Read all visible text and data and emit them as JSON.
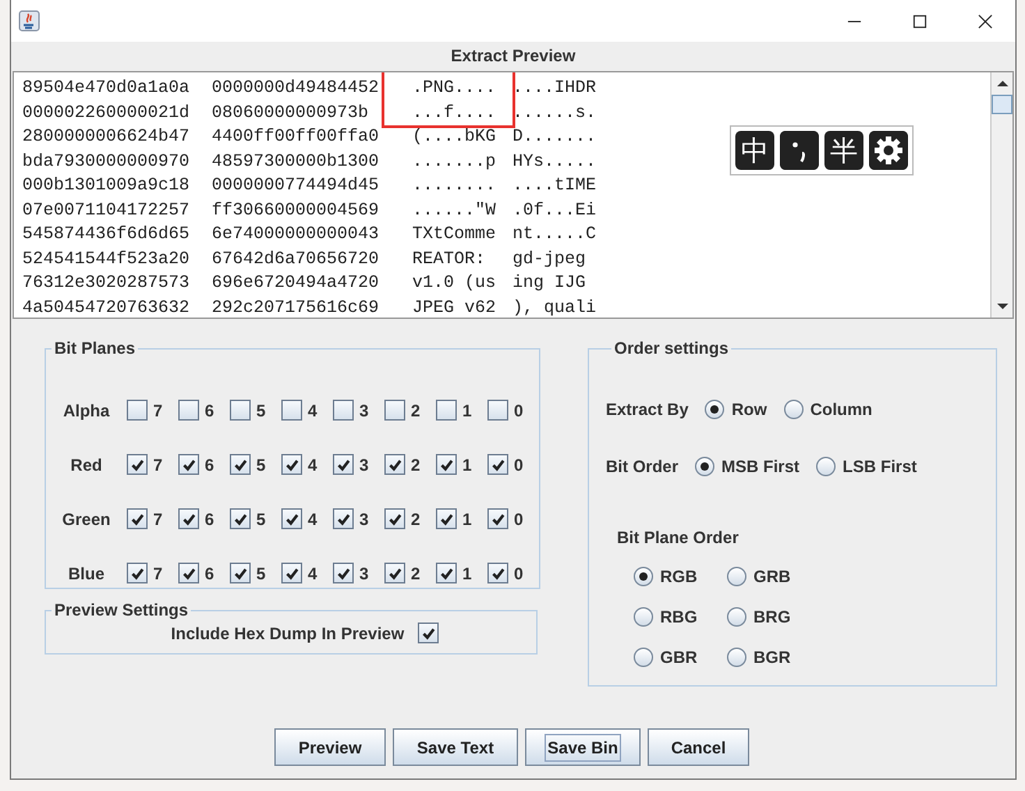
{
  "window": {
    "title": "Extract Preview"
  },
  "preview": {
    "rows": [
      {
        "hex": [
          "89504e470d0a1a0a",
          "0000000d49484452"
        ],
        "ascii": [
          ".PNG....",
          "....IHDR"
        ]
      },
      {
        "hex": [
          "000002260000021d",
          "08060000000973b"
        ],
        "ascii": [
          "...f....",
          "......s."
        ]
      },
      {
        "hex": [
          "2800000006624b47",
          "4400ff00ff00ffa0"
        ],
        "ascii": [
          "(....bKG",
          "D......."
        ]
      },
      {
        "hex": [
          "bda7930000000970",
          "48597300000b1300"
        ],
        "ascii": [
          ".......p",
          "HYs....."
        ]
      },
      {
        "hex": [
          "000b1301009a9c18",
          "0000000774494d45"
        ],
        "ascii": [
          "........",
          "....tIME"
        ]
      },
      {
        "hex": [
          "07e0071104172257",
          "ff30660000004569"
        ],
        "ascii": [
          "......\"W",
          ".0f...Ei"
        ]
      },
      {
        "hex": [
          "545874436f6d6d65",
          "6e74000000000043"
        ],
        "ascii": [
          "TXtComme",
          "nt.....C"
        ]
      },
      {
        "hex": [
          "524541544f523a20",
          "67642d6a70656720"
        ],
        "ascii": [
          "REATOR: ",
          "gd-jpeg"
        ]
      },
      {
        "hex": [
          "76312e3020287573",
          "696e6720494a4720"
        ],
        "ascii": [
          "v1.0 (us",
          "ing IJG"
        ]
      },
      {
        "hex": [
          "4a50454720763632",
          "292c207175616c69"
        ],
        "ascii": [
          "JPEG v62",
          "), quali"
        ]
      }
    ],
    "highlight": {
      "color": "#e8322e"
    }
  },
  "ime_toolbar": {
    "items": [
      {
        "kind": "text",
        "label": "中"
      },
      {
        "kind": "punctuation"
      },
      {
        "kind": "text",
        "label": "半"
      },
      {
        "kind": "settings"
      }
    ]
  },
  "bit_planes": {
    "title": "Bit Planes",
    "channels": [
      {
        "name": "Alpha",
        "bits": [
          {
            "label": "7",
            "checked": false
          },
          {
            "label": "6",
            "checked": false
          },
          {
            "label": "5",
            "checked": false
          },
          {
            "label": "4",
            "checked": false
          },
          {
            "label": "3",
            "checked": false
          },
          {
            "label": "2",
            "checked": false
          },
          {
            "label": "1",
            "checked": false
          },
          {
            "label": "0",
            "checked": false
          }
        ]
      },
      {
        "name": "Red",
        "bits": [
          {
            "label": "7",
            "checked": true
          },
          {
            "label": "6",
            "checked": true
          },
          {
            "label": "5",
            "checked": true
          },
          {
            "label": "4",
            "checked": true
          },
          {
            "label": "3",
            "checked": true
          },
          {
            "label": "2",
            "checked": true
          },
          {
            "label": "1",
            "checked": true
          },
          {
            "label": "0",
            "checked": true
          }
        ]
      },
      {
        "name": "Green",
        "bits": [
          {
            "label": "7",
            "checked": true
          },
          {
            "label": "6",
            "checked": true
          },
          {
            "label": "5",
            "checked": true
          },
          {
            "label": "4",
            "checked": true
          },
          {
            "label": "3",
            "checked": true
          },
          {
            "label": "2",
            "checked": true
          },
          {
            "label": "1",
            "checked": true
          },
          {
            "label": "0",
            "checked": true
          }
        ]
      },
      {
        "name": "Blue",
        "bits": [
          {
            "label": "7",
            "checked": true
          },
          {
            "label": "6",
            "checked": true
          },
          {
            "label": "5",
            "checked": true
          },
          {
            "label": "4",
            "checked": true
          },
          {
            "label": "3",
            "checked": true
          },
          {
            "label": "2",
            "checked": true
          },
          {
            "label": "1",
            "checked": true
          },
          {
            "label": "0",
            "checked": true
          }
        ]
      }
    ]
  },
  "preview_settings": {
    "title": "Preview Settings",
    "label": "Include Hex Dump In Preview",
    "checked": true
  },
  "order_settings": {
    "title": "Order settings",
    "extract_by": {
      "label": "Extract By",
      "options": [
        {
          "label": "Row",
          "selected": true
        },
        {
          "label": "Column",
          "selected": false
        }
      ]
    },
    "bit_order": {
      "label": "Bit Order",
      "options": [
        {
          "label": "MSB First",
          "selected": true
        },
        {
          "label": "LSB First",
          "selected": false
        }
      ]
    },
    "bit_plane_order": {
      "label": "Bit Plane Order",
      "options": [
        {
          "label": "RGB",
          "selected": true
        },
        {
          "label": "GRB",
          "selected": false
        },
        {
          "label": "RBG",
          "selected": false
        },
        {
          "label": "BRG",
          "selected": false
        },
        {
          "label": "GBR",
          "selected": false
        },
        {
          "label": "BGR",
          "selected": false
        }
      ]
    }
  },
  "buttons": [
    {
      "label": "Preview",
      "focused": false
    },
    {
      "label": "Save Text",
      "focused": false
    },
    {
      "label": "Save Bin",
      "focused": true
    },
    {
      "label": "Cancel",
      "focused": false
    }
  ]
}
